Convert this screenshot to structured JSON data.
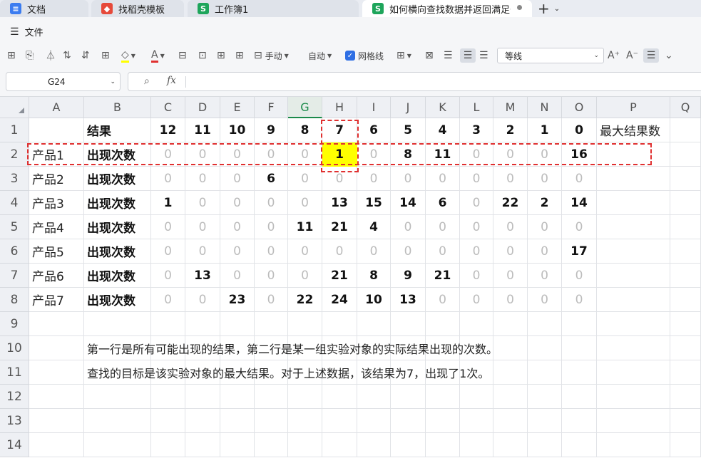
{
  "tabs": [
    {
      "label": "文档",
      "icon": "doc-icon",
      "glyph": "≡"
    },
    {
      "label": "找稻壳模板",
      "icon": "docer-icon",
      "glyph": "◆"
    },
    {
      "label": "工作簿1",
      "icon": "sheet-icon",
      "glyph": "S"
    },
    {
      "label": "如何横向查找数据并返回满足条件",
      "icon": "sheet-icon",
      "glyph": "S"
    }
  ],
  "menu": {
    "file_label": "文件"
  },
  "toolbar": {
    "manual_label": "手动",
    "auto_label": "自动",
    "gridlines_label": "网格线",
    "font_name": "等线"
  },
  "formula_bar": {
    "cell_ref": "G24",
    "fx_label": "fx",
    "formula": ""
  },
  "columns": [
    "A",
    "B",
    "C",
    "D",
    "E",
    "F",
    "G",
    "H",
    "I",
    "J",
    "K",
    "L",
    "M",
    "N",
    "O",
    "P",
    "Q"
  ],
  "selected_column": "G",
  "row_numbers": [
    "1",
    "2",
    "3",
    "4",
    "5",
    "6",
    "7",
    "8",
    "9",
    "10",
    "11",
    "12",
    "13",
    "14"
  ],
  "sheet": {
    "header_row": {
      "b": "结果",
      "values": [
        "12",
        "11",
        "10",
        "9",
        "8",
        "7",
        "6",
        "5",
        "4",
        "3",
        "2",
        "1",
        "0"
      ],
      "p": "最大结果数"
    },
    "rows": [
      {
        "a": "产品1",
        "b": "出现次数",
        "values": [
          "0",
          "0",
          "0",
          "0",
          "0",
          "1",
          "0",
          "8",
          "11",
          "0",
          "0",
          "0",
          "16"
        ]
      },
      {
        "a": "产品2",
        "b": "出现次数",
        "values": [
          "0",
          "0",
          "0",
          "6",
          "0",
          "0",
          "0",
          "0",
          "0",
          "0",
          "0",
          "0",
          "0"
        ]
      },
      {
        "a": "产品3",
        "b": "出现次数",
        "values": [
          "1",
          "0",
          "0",
          "0",
          "0",
          "13",
          "15",
          "14",
          "6",
          "0",
          "22",
          "2",
          "14"
        ]
      },
      {
        "a": "产品4",
        "b": "出现次数",
        "values": [
          "0",
          "0",
          "0",
          "0",
          "11",
          "21",
          "4",
          "0",
          "0",
          "0",
          "0",
          "0",
          "0"
        ]
      },
      {
        "a": "产品5",
        "b": "出现次数",
        "values": [
          "0",
          "0",
          "0",
          "0",
          "0",
          "0",
          "0",
          "0",
          "0",
          "0",
          "0",
          "0",
          "17"
        ]
      },
      {
        "a": "产品6",
        "b": "出现次数",
        "values": [
          "0",
          "13",
          "0",
          "0",
          "0",
          "21",
          "8",
          "9",
          "21",
          "0",
          "0",
          "0",
          "0"
        ]
      },
      {
        "a": "产品7",
        "b": "出现次数",
        "values": [
          "0",
          "0",
          "23",
          "0",
          "22",
          "24",
          "10",
          "13",
          "0",
          "0",
          "0",
          "0",
          "0"
        ]
      }
    ],
    "notes": [
      "第一行是所有可能出现的结果，第二行是某一组实验对象的实际结果出现的次数。",
      "查找的目标是该实验对象的最大结果。对于上述数据，该结果为7，出现了1次。"
    ]
  },
  "colors": {
    "highlight": "#ffff00",
    "dash": "#e03030",
    "selected_header": "#1b8a4a"
  }
}
